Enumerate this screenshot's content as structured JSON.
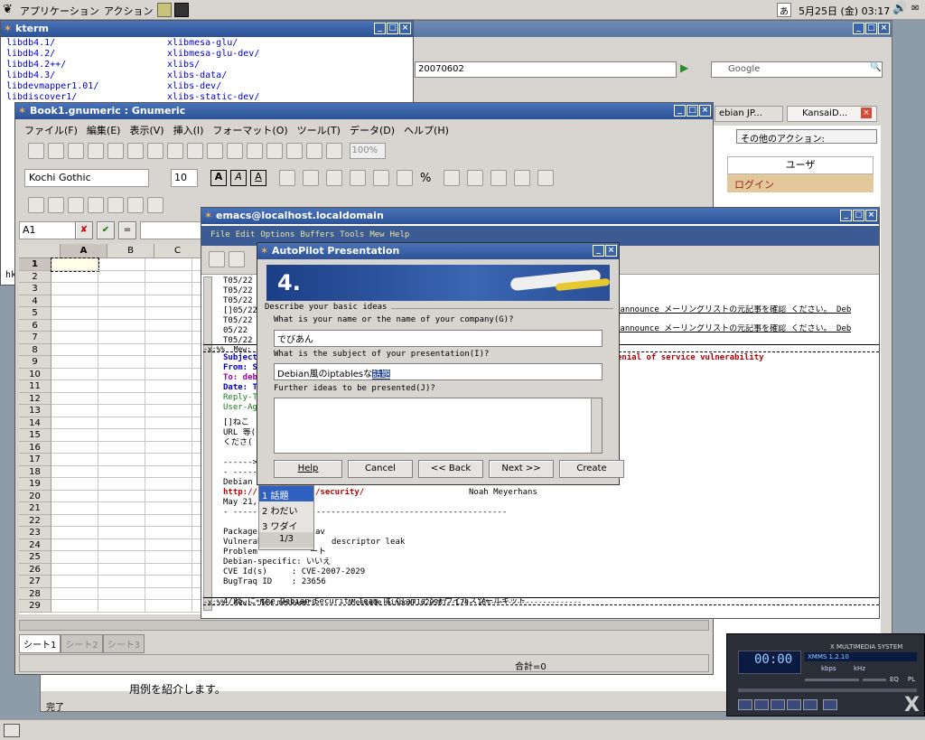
{
  "top_panel": {
    "apps": "アプリケーション",
    "actions": "アクション",
    "date": "5月25日 (金) 03:17",
    "input_indicator": "あ"
  },
  "kterm": {
    "title": "kterm",
    "col1": [
      "libdb4.1/",
      "libdb4.2/",
      "libdb4.2++/",
      "libdb4.3/",
      "libdevmapper1.01/",
      "libdiscover1/"
    ],
    "col2": [
      "xlibmesa-glu/",
      "xlibmesa-glu-dev/",
      "xlibs/",
      "xlibs-data/",
      "xlibs-dev/",
      "xlibs-static-dev/"
    ],
    "prompt": "hk"
  },
  "browser": {
    "url_fragment": "20070602",
    "search_placeholder": "Google",
    "tab1": "ebian JP...",
    "tab2": "KansaiD...",
    "close_tab": "×",
    "other_actions": "その他のアクション:",
    "user_header": "ユーザ",
    "login": "ログイン",
    "bottom_text": "用例を紹介します。",
    "status": "完了"
  },
  "gnumeric": {
    "title": "Book1.gnumeric : Gnumeric",
    "menu": [
      "ファイル(F)",
      "編集(E)",
      "表示(V)",
      "挿入(I)",
      "フォーマット(O)",
      "ツール(T)",
      "データ(D)",
      "ヘルプ(H)"
    ],
    "zoom": "100%",
    "font": "Kochi Gothic",
    "font_size": "10",
    "format_bold": "A",
    "format_italic": "A",
    "format_underline": "A",
    "percent": "%",
    "cell_ref": "A1",
    "formula_cancel": "✘",
    "formula_accept": "✔",
    "formula_equals": "=",
    "columns": [
      "A",
      "B",
      "C"
    ],
    "rows": [
      "1",
      "2",
      "3",
      "4",
      "5",
      "6",
      "7",
      "8",
      "9",
      "10",
      "11",
      "12",
      "13",
      "14",
      "15",
      "16",
      "17",
      "18",
      "19",
      "20",
      "21",
      "22",
      "23",
      "24",
      "25",
      "26",
      "27",
      "28",
      "29"
    ],
    "sheet_tabs": [
      "シート1",
      "シート2",
      "シート3"
    ],
    "sum": "合計=0"
  },
  "emacs": {
    "title": "emacs@localhost.localdomain",
    "menu": [
      "File",
      "Edit",
      "Options",
      "Buffers",
      "Tools",
      "Mew",
      "Help"
    ],
    "top_lines": [
      "T05/22",
      "T05/22",
      "T05/22",
      "[]05/22",
      "T05/22",
      "05/22",
      "T05/22"
    ],
    "announce": "-announce メーリングリストの元記事を確認 ください。 Deb",
    "modeline1": "-x:%%  Mew:",
    "header_subject": "Subject:",
    "header_from": "From: S",
    "header_to": "To: deb",
    "header_date": "Date: T",
    "header_reply": "Reply-T",
    "header_ua": "User-Ag",
    "deny": "enial of service vulnerability",
    "body1": "[]ねこ",
    "body2": "URL 等(",
    "body3": "くださ(",
    "sep1": "------>",
    "sep2": "- -----",
    "debian": "Debian ",
    "http": "http://",
    "security": "/security/",
    "author": "Noah Meyerhans",
    "date": "May 21, ",
    "dashes": "- --------------------------------------------------------",
    "package": "Package",
    "package_val": "av",
    "vuln": "Vulnerab",
    "vuln_val": "descriptor leak",
    "problem": "Problem",
    "problem_val": "ート",
    "debspec": "Debian-specific: いいえ",
    "cve": "CVE Id(s)     : CVE-2007-2029",
    "bugtraq": "BugTraq ID    : 23656",
    "last_line": "4/25 に the Debian Security Team は Clam アンチウイルスツールキット",
    "modeline2": "-x:%%  Mew: *New message*0       (Message %inbox/162096)--L74--18%---------------------"
  },
  "autopilot": {
    "title": "AutoPilot Presentation",
    "step": "4.",
    "section": "Describe your basic ideas",
    "q1": "What is your name or the name of your company(G)?",
    "a1": "でびあん",
    "q2": "What is the subject of your presentation(I)?",
    "a2_prefix": "Debian風のiptablesな",
    "a2_selected": "話題",
    "q3": "Further ideas to be presented(J)?",
    "buttons": [
      "Help",
      "Cancel",
      "<< Back",
      "Next >>",
      "Create"
    ]
  },
  "ime": {
    "candidates": [
      "1 話題",
      "2 わだい",
      "3 ワダイ"
    ],
    "page": "1/3"
  },
  "xmms": {
    "title": "X MULTIMEDIA SYSTEM",
    "track": "XMMS 1.2.10",
    "kbps": "kbps",
    "khz": "kHz",
    "time": "00:00",
    "eq": "EQ",
    "pl": "PL"
  }
}
